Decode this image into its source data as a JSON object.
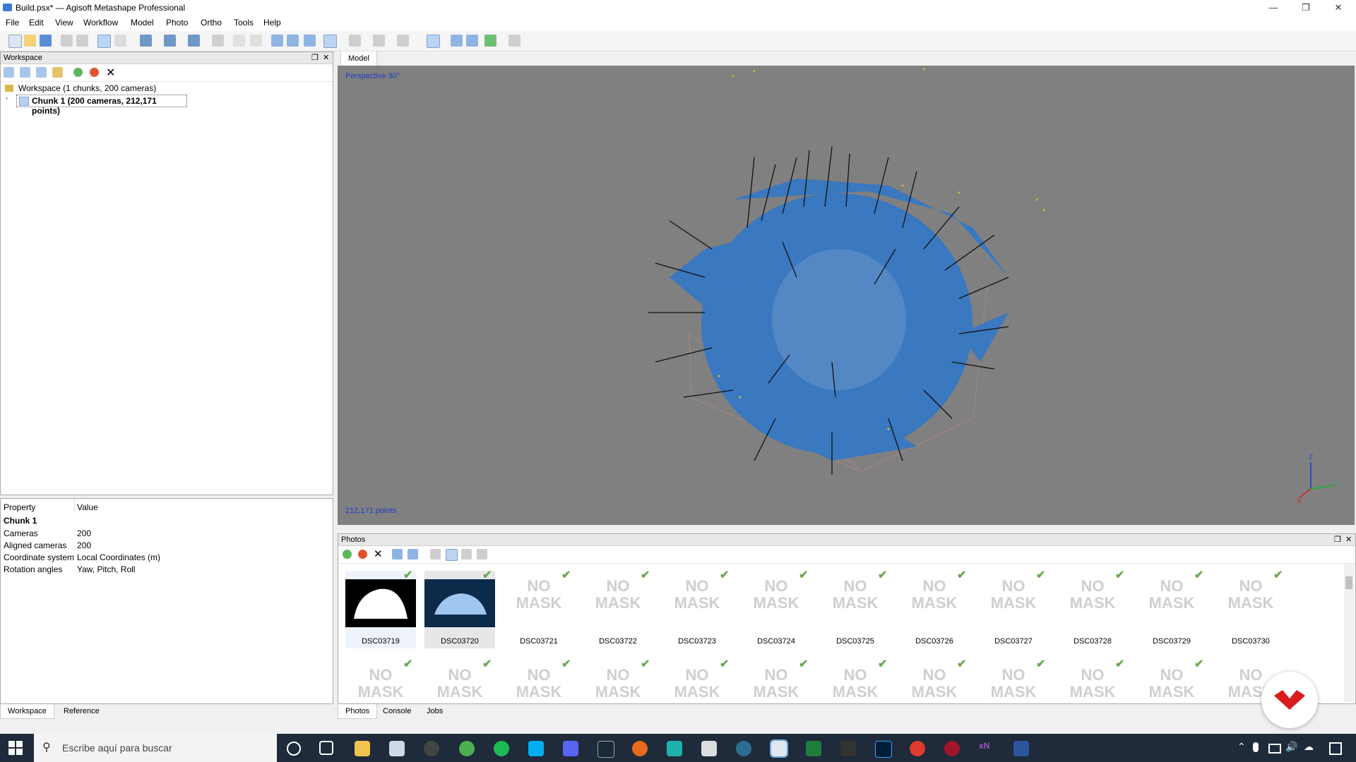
{
  "window": {
    "title": "Build.psx* — Agisoft Metashape Professional"
  },
  "menu": [
    "File",
    "Edit",
    "View",
    "Workflow",
    "Model",
    "Photo",
    "Ortho",
    "Tools",
    "Help"
  ],
  "workspace": {
    "header": "Workspace",
    "root_label": "Workspace (1 chunks, 200 cameras)",
    "chunk_label": "Chunk 1 (200 cameras, 212,171 points)"
  },
  "properties": {
    "col_property": "Property",
    "col_value": "Value",
    "section": "Chunk 1",
    "rows": [
      {
        "k": "Cameras",
        "v": "200"
      },
      {
        "k": "Aligned cameras",
        "v": "200"
      },
      {
        "k": "Coordinate system",
        "v": "Local Coordinates (m)"
      },
      {
        "k": "Rotation angles",
        "v": "Yaw, Pitch, Roll"
      }
    ]
  },
  "left_tabs": [
    "Workspace",
    "Reference"
  ],
  "viewport": {
    "tab": "Model",
    "perspective": "Perspective 30°",
    "points": "212,171 points",
    "axis": {
      "z": "Z",
      "y": "Y",
      "x": "X"
    }
  },
  "photos": {
    "header": "Photos",
    "no_mask_line1": "NO",
    "no_mask_line2": "MASK",
    "row1": [
      "DSC03719",
      "DSC03720",
      "DSC03721",
      "DSC03722",
      "DSC03723",
      "DSC03724",
      "DSC03725",
      "DSC03726",
      "DSC03727",
      "DSC03728",
      "DSC03729",
      "DSC03730"
    ]
  },
  "bottom_tabs": [
    "Photos",
    "Console",
    "Jobs"
  ],
  "taskbar": {
    "search_placeholder": "Escribe aquí para buscar"
  },
  "colors": {
    "viewport_bg": "#808080",
    "mesh_blue": "#3a78c0",
    "check_green": "#6aa84f",
    "taskbar": "#1f2a3a"
  }
}
